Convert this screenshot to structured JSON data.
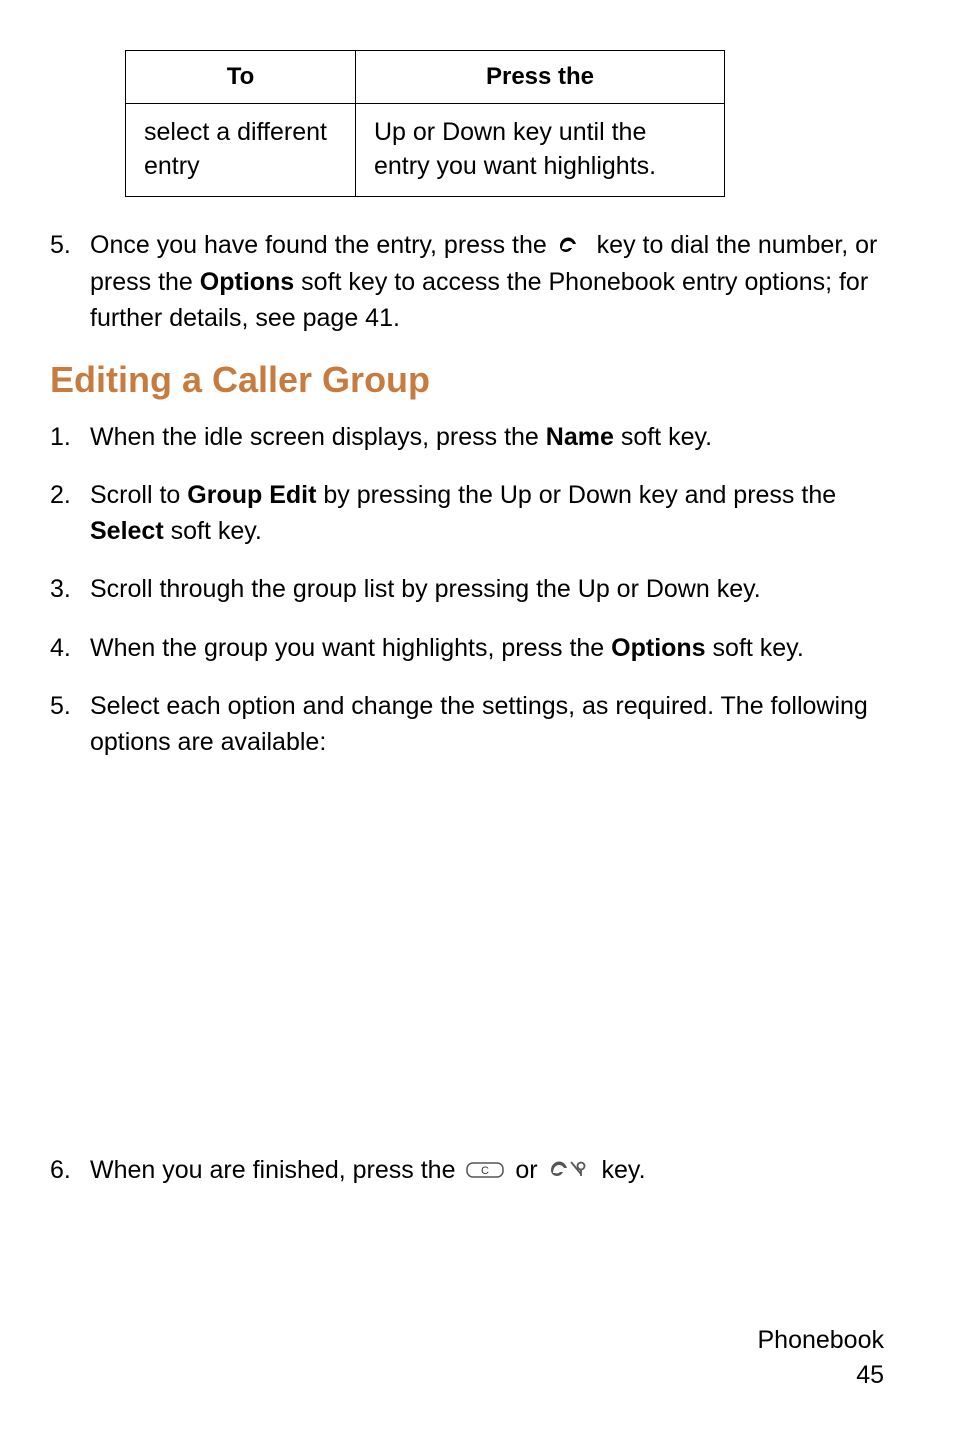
{
  "table": {
    "headers": {
      "col1": "To",
      "col2": "Press the"
    },
    "row": {
      "col1": "select a different entry",
      "col2": "Up or Down key until the entry you want highlights."
    }
  },
  "step5_before": {
    "num": "5.",
    "text_part1": "Once you have found the entry, press the ",
    "text_part2": " key to dial the number, or press the ",
    "bold_options": "Options",
    "text_part3": " soft key to access the Phonebook entry options; for further details, see page 41."
  },
  "heading": "Editing a Caller Group",
  "steps": {
    "s1": {
      "num": "1.",
      "t1": "When the idle screen displays, press the ",
      "b1": "Name",
      "t2": " soft key."
    },
    "s2": {
      "num": "2.",
      "t1": "Scroll to ",
      "b1": "Group Edit",
      "t2": " by pressing the Up or Down key and press the ",
      "b2": "Select",
      "t3": " soft key."
    },
    "s3": {
      "num": "3.",
      "t1": "Scroll through the group list by pressing the Up or Down key."
    },
    "s4": {
      "num": "4.",
      "t1": "When the group you want highlights, press the ",
      "b1": "Options",
      "t2": " soft key."
    },
    "s5": {
      "num": "5.",
      "t1": "Select each option and change the settings, as required. The following options are available:"
    },
    "s6": {
      "num": "6.",
      "t1": "When you are finished, press the ",
      "t2": " or ",
      "t3": "  key."
    }
  },
  "footer": {
    "label": "Phonebook",
    "page": "45"
  },
  "icons": {
    "send": "send-key-icon",
    "c": "c-key-icon",
    "end": "end-key-icon"
  }
}
